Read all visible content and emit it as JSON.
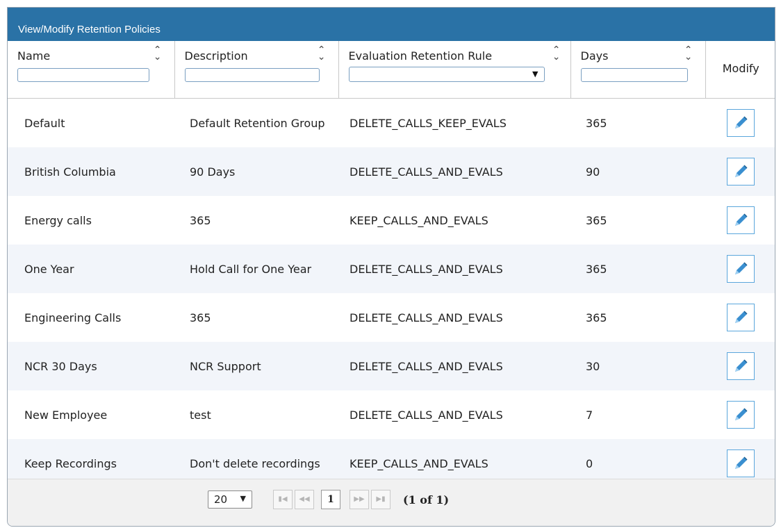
{
  "panel": {
    "title": "View/Modify Retention Policies"
  },
  "columns": {
    "name": "Name",
    "description": "Description",
    "rule": "Evaluation Retention Rule",
    "days": "Days",
    "modify": "Modify"
  },
  "rows": [
    {
      "name": "Default",
      "description": "Default Retention Group",
      "rule": "DELETE_CALLS_KEEP_EVALS",
      "days": "365"
    },
    {
      "name": "British Columbia",
      "description": "90 Days",
      "rule": "DELETE_CALLS_AND_EVALS",
      "days": "90"
    },
    {
      "name": "Energy calls",
      "description": "365",
      "rule": "KEEP_CALLS_AND_EVALS",
      "days": "365"
    },
    {
      "name": "One Year",
      "description": "Hold Call for One Year",
      "rule": "DELETE_CALLS_AND_EVALS",
      "days": "365"
    },
    {
      "name": "Engineering Calls",
      "description": "365",
      "rule": "DELETE_CALLS_AND_EVALS",
      "days": "365"
    },
    {
      "name": "NCR 30 Days",
      "description": "NCR Support",
      "rule": "DELETE_CALLS_AND_EVALS",
      "days": "30"
    },
    {
      "name": "New Employee",
      "description": "test",
      "rule": "DELETE_CALLS_AND_EVALS",
      "days": "7"
    },
    {
      "name": "Keep Recordings",
      "description": "Don't delete recordings",
      "rule": "KEEP_CALLS_AND_EVALS",
      "days": "0"
    }
  ],
  "paginator": {
    "rows_per_page": "20",
    "current_page": "1",
    "status": "(1 of 1)",
    "icons": {
      "first": "first-page-icon",
      "prev": "prev-page-icon",
      "next": "next-page-icon",
      "last": "last-page-icon"
    }
  },
  "icons": {
    "sort": "sort-icon",
    "edit": "pencil-icon",
    "dropdown": "chevron-down-icon"
  },
  "colors": {
    "title_bar": "#2a72a6",
    "row_alt": "#f2f5fa",
    "edit_border": "#5aa6dc",
    "pencil": "#3a8fd0"
  }
}
